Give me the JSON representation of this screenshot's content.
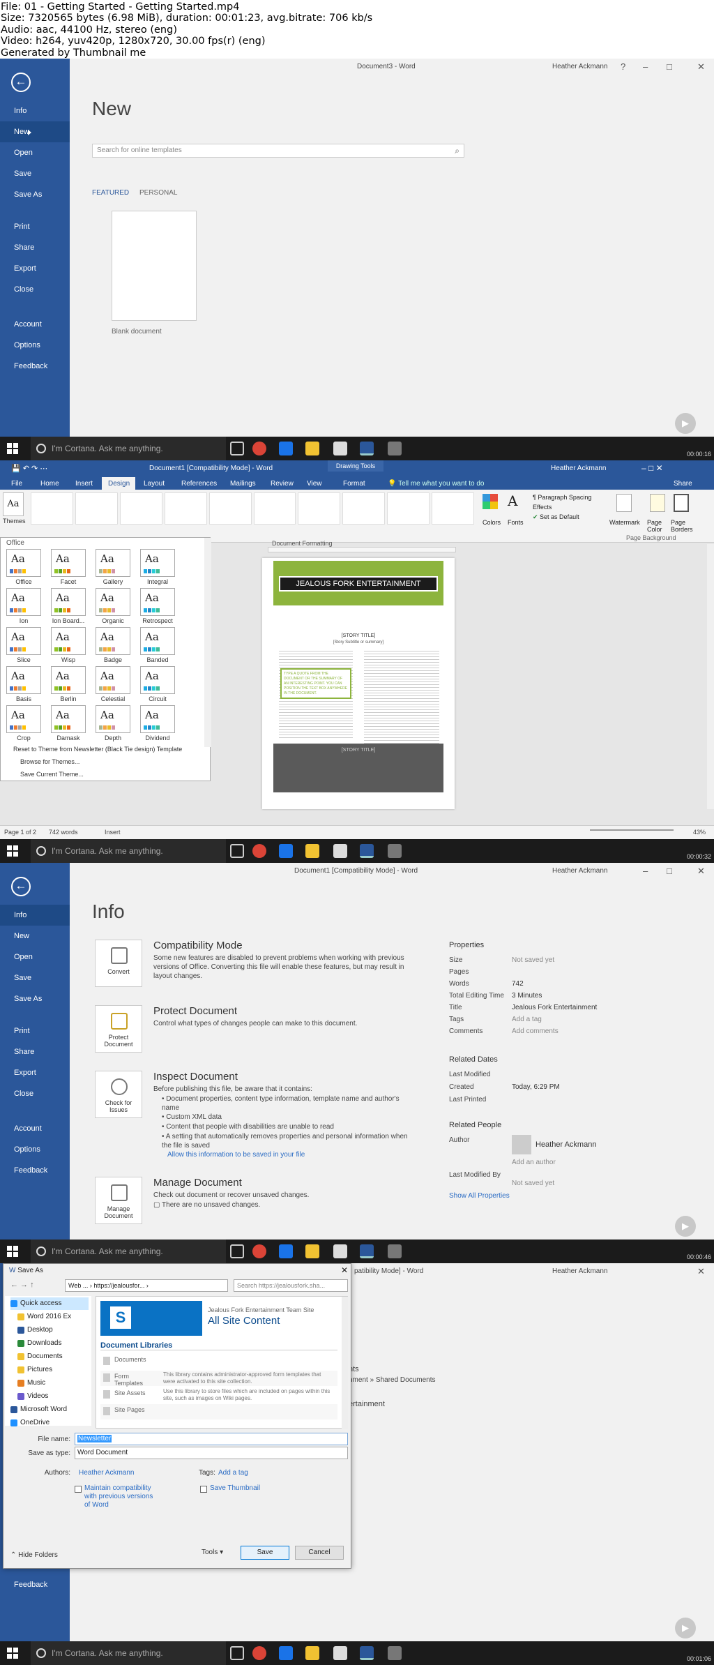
{
  "meta": {
    "lines": [
      "File: 01 - Getting Started - Getting Started.mp4",
      "Size: 7320565 bytes (6.98 MiB), duration: 00:01:23, avg.bitrate: 706 kb/s",
      "Audio: aac, 44100 Hz, stereo (eng)",
      "Video: h264, yuv420p, 1280x720, 30.00 fps(r) (eng)",
      "Generated by Thumbnail me"
    ]
  },
  "taskbar": {
    "search_placeholder": "I'm Cortana. Ask me anything."
  },
  "frame1": {
    "window_title": "Document3 - Word",
    "user": "Heather Ackmann",
    "page_title": "New",
    "search_placeholder": "Search for online templates",
    "tab_featured": "FEATURED",
    "tab_personal": "PERSONAL",
    "blank_label": "Blank document",
    "timestamp": "00:00:16",
    "nav": [
      "Info",
      "New",
      "Open",
      "Save",
      "Save As",
      "Print",
      "Share",
      "Export",
      "Close",
      "Account",
      "Options",
      "Feedback"
    ]
  },
  "frame2": {
    "window_title": "Document1 [Compatibility Mode] - Word",
    "drawing_tools": "Drawing Tools",
    "user": "Heather Ackmann",
    "share": "Share",
    "tell_me": "Tell me what you want to do",
    "tabs": [
      "File",
      "Home",
      "Insert",
      "Design",
      "Layout",
      "References",
      "Mailings",
      "Review",
      "View",
      "Format"
    ],
    "themes_btn": "Themes",
    "colors_btn": "Colors",
    "fonts_btn": "Fonts",
    "para_spacing": "Paragraph Spacing",
    "effects": "Effects",
    "set_default": "Set as Default",
    "watermark": "Watermark",
    "page_color": "Page Color",
    "page_borders": "Page Borders",
    "page_background": "Page Background",
    "doc_formatting": "Document Formatting",
    "gallery_heading": "Office",
    "themes": [
      "Office",
      "Facet",
      "Gallery",
      "Integral",
      "Ion",
      "Ion Board...",
      "Organic",
      "Retrospect",
      "Slice",
      "Wisp",
      "Badge",
      "Banded",
      "Basis",
      "Berlin",
      "Celestial",
      "Circuit",
      "Crop",
      "Damask",
      "Depth",
      "Dividend"
    ],
    "reset_theme": "Reset to Theme from Newsletter (Black Tie design) Template",
    "browse_themes": "Browse for Themes...",
    "save_theme": "Save Current Theme...",
    "doc_banner": "JEALOUS FORK ENTERTAINMENT",
    "doc_story": "[STORY TITLE]",
    "doc_story_sub": "[Story Subtitle or summary]",
    "doc_callout": "TYPE A QUOTE FROM THE DOCUMENT OR THE SUMMARY OF AN INTERESTING POINT. YOU CAN POSITION THE TEXT BOX ANYWHERE IN THE DOCUMENT.",
    "doc_story2": "[STORY TITLE]",
    "status_page": "Page 1 of 2",
    "status_words": "742 words",
    "status_mode": "Insert",
    "zoom": "43%",
    "timestamp": "00:00:32"
  },
  "frame3": {
    "window_title": "Document1 [Compatibility Mode] - Word",
    "user": "Heather Ackmann",
    "page_title": "Info",
    "nav": [
      "Info",
      "New",
      "Open",
      "Save",
      "Save As",
      "Print",
      "Share",
      "Export",
      "Close",
      "Account",
      "Options",
      "Feedback"
    ],
    "compat_title": "Compatibility Mode",
    "compat_desc": "Some new features are disabled to prevent problems when working with previous versions of Office. Converting this file will enable these features, but may result in layout changes.",
    "convert_btn": "Convert",
    "protect_title": "Protect Document",
    "protect_desc": "Control what types of changes people can make to this document.",
    "protect_btn": "Protect Document",
    "inspect_title": "Inspect Document",
    "inspect_desc": "Before publishing this file, be aware that it contains:",
    "inspect_items": [
      "Document properties, content type information, template name and author's name",
      "Custom XML data",
      "Content that people with disabilities are unable to read",
      "A setting that automatically removes properties and personal information when the file is saved"
    ],
    "inspect_link": "Allow this information to be saved in your file",
    "inspect_btn": "Check for Issues",
    "manage_title": "Manage Document",
    "manage_desc": "Check out document or recover unsaved changes.",
    "manage_item": "There are no unsaved changes.",
    "manage_btn": "Manage Document",
    "properties_title": "Properties",
    "props": [
      {
        "k": "Size",
        "v": "Not saved yet"
      },
      {
        "k": "Pages",
        "v": ""
      },
      {
        "k": "Words",
        "v": "742"
      },
      {
        "k": "Total Editing Time",
        "v": "3 Minutes"
      },
      {
        "k": "Title",
        "v": "Jealous Fork Entertainment"
      },
      {
        "k": "Tags",
        "v": "Add a tag"
      },
      {
        "k": "Comments",
        "v": "Add comments"
      }
    ],
    "related_dates": "Related Dates",
    "dates": [
      {
        "k": "Last Modified",
        "v": ""
      },
      {
        "k": "Created",
        "v": "Today, 6:29 PM"
      },
      {
        "k": "Last Printed",
        "v": ""
      }
    ],
    "related_people": "Related People",
    "author_label": "Author",
    "author_name": "Heather Ackmann",
    "add_author": "Add an author",
    "last_modified_by": "Last Modified By",
    "not_saved": "Not saved yet",
    "show_all": "Show All Properties",
    "timestamp": "00:00:46"
  },
  "frame4": {
    "behind_title": "patibility Mode] - Word",
    "behind_user": "Heather Ackmann",
    "behind_line1": "nts",
    "behind_line2": "nment » Shared Documents",
    "behind_line3": "ertainment",
    "feedback": "Feedback",
    "dialog_title": "Save As",
    "address": "Web ... › https://jealousfor... ›",
    "search_placeholder": "Search https://jealousfork.sha...",
    "nav": [
      "Quick access",
      "Word 2016 Ex",
      "Desktop",
      "Downloads",
      "Documents",
      "Pictures",
      "Music",
      "Videos",
      "Microsoft Word",
      "OneDrive"
    ],
    "sp_site": "Jealous Fork Entertainment Team Site",
    "sp_all": "All Site Content",
    "doc_libraries": "Document Libraries",
    "libs": [
      {
        "name": "Documents",
        "desc": ""
      },
      {
        "name": "Form Templates",
        "desc": "This library contains administrator-approved form templates that were activated to this site collection."
      },
      {
        "name": "Site Assets",
        "desc": "Use this library to store files which are included on pages within this site, such as images on Wiki pages."
      },
      {
        "name": "Site Pages",
        "desc": ""
      }
    ],
    "file_name_label": "File name:",
    "file_name": "Newsletter",
    "save_type_label": "Save as type:",
    "save_type": "Word Document",
    "authors_label": "Authors:",
    "authors": "Heather Ackmann",
    "tags_label": "Tags:",
    "tags": "Add a tag",
    "maintain": "Maintain compatibility with previous versions of Word",
    "save_thumbnail": "Save Thumbnail",
    "hide_folders": "Hide Folders",
    "tools": "Tools",
    "save": "Save",
    "cancel": "Cancel",
    "timestamp": "00:01:06"
  },
  "colors": {
    "word_blue": "#2b579a",
    "word_dark": "#1e4a86",
    "link": "#2b6cc4",
    "doc_green": "#8db43d",
    "taskbar": "#1b1b1b"
  }
}
